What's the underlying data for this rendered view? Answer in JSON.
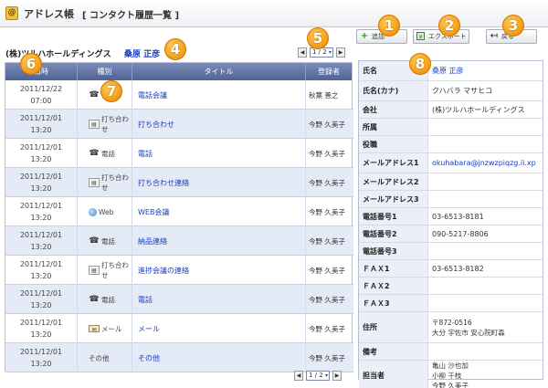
{
  "app": {
    "icon_name": "address-book-icon",
    "title": "アドレス帳",
    "subtitle": "[ コンタクト履歴一覧 ]"
  },
  "toolbar": {
    "add_label": "追加",
    "export_label": "エクスポート",
    "back_label": "戻る"
  },
  "badges": [
    "1",
    "2",
    "3",
    "4",
    "5",
    "6",
    "7",
    "8"
  ],
  "company": {
    "name": "(株)ツルハホールディングス",
    "person": "桑原 正彦"
  },
  "pager": {
    "prev": "◀",
    "next": "▶",
    "current": "1 / 2"
  },
  "history": {
    "columns": [
      "日時",
      "種別",
      "タイトル",
      "登録者"
    ],
    "rows": [
      {
        "date": "2011/12/22",
        "time": "07:00",
        "type": "電話",
        "type_icon": "phone-icon",
        "title": "電話会議",
        "user": "秋葉 善之"
      },
      {
        "date": "2011/12/01",
        "time": "13:20",
        "type": "打ち合わせ",
        "type_icon": "memo-icon",
        "title": "打ち合わせ",
        "user": "今野 久美子"
      },
      {
        "date": "2011/12/01",
        "time": "13:20",
        "type": "電話",
        "type_icon": "phone-icon",
        "title": "電話",
        "user": "今野 久美子"
      },
      {
        "date": "2011/12/01",
        "time": "13:20",
        "type": "打ち合わせ",
        "type_icon": "memo-icon",
        "title": "打ち合わせ連絡",
        "user": "今野 久美子"
      },
      {
        "date": "2011/12/01",
        "time": "13:20",
        "type": "Web",
        "type_icon": "web-icon",
        "title": "WEB会議",
        "user": "今野 久美子"
      },
      {
        "date": "2011/12/01",
        "time": "13:20",
        "type": "電話",
        "type_icon": "phone-icon",
        "title": "納品連絡",
        "user": "今野 久美子"
      },
      {
        "date": "2011/12/01",
        "time": "13:20",
        "type": "打ち合わせ",
        "type_icon": "memo-icon",
        "title": "進捗会議の連絡",
        "user": "今野 久美子"
      },
      {
        "date": "2011/12/01",
        "time": "13:20",
        "type": "電話",
        "type_icon": "phone-icon",
        "title": "電話",
        "user": "今野 久美子"
      },
      {
        "date": "2011/12/01",
        "time": "13:20",
        "type": "メール",
        "type_icon": "mail-icon",
        "title": "メール",
        "user": "今野 久美子"
      },
      {
        "date": "2011/12/01",
        "time": "13:20",
        "type": "その他",
        "type_icon": "",
        "title": "その他",
        "user": "今野 久美子"
      }
    ]
  },
  "detail": [
    {
      "label": "氏名",
      "value": "桑原 正彦",
      "link": true
    },
    {
      "label": "氏名(カナ)",
      "value": "クハバラ マサヒコ"
    },
    {
      "label": "会社",
      "value": "(株)ツルハホールディングス"
    },
    {
      "label": "所属",
      "value": ""
    },
    {
      "label": "役職",
      "value": ""
    },
    {
      "label": "メールアドレス1",
      "value": "okuhabara@jnzwzpiqzg.ii.xp",
      "link": true
    },
    {
      "label": "メールアドレス2",
      "value": ""
    },
    {
      "label": "メールアドレス3",
      "value": ""
    },
    {
      "label": "電話番号1",
      "value": "03-6513-8181"
    },
    {
      "label": "電話番号2",
      "value": "090-5217-8806"
    },
    {
      "label": "電話番号3",
      "value": ""
    },
    {
      "label": "ＦＡＸ1",
      "value": "03-6513-8182"
    },
    {
      "label": "ＦＡＸ2",
      "value": ""
    },
    {
      "label": "ＦＡＸ3",
      "value": ""
    },
    {
      "label": "住所",
      "lines": [
        "〒872-0516",
        "大分 宇佐市 安心院町森"
      ]
    },
    {
      "label": "備考",
      "value": ""
    },
    {
      "label": "担当者",
      "lines": [
        "亀山 沙也加",
        "小柳 千枝",
        "今野 久美子"
      ]
    }
  ]
}
